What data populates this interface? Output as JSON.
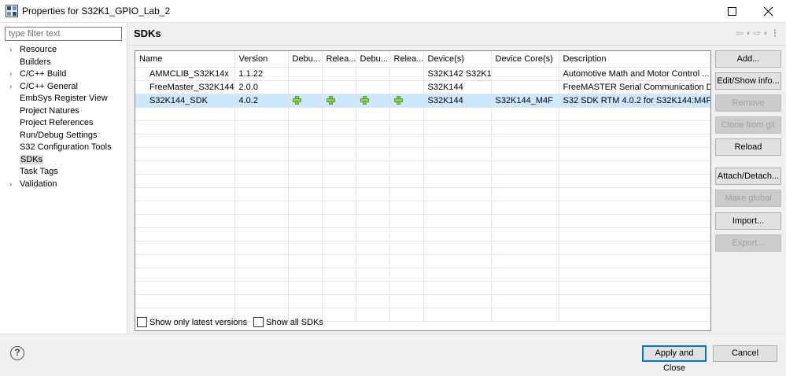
{
  "window": {
    "title": "Properties for S32K1_GPIO_Lab_2"
  },
  "filter": {
    "placeholder": "type filter text"
  },
  "tree": [
    {
      "label": "Resource",
      "expandable": true
    },
    {
      "label": "Builders",
      "expandable": false
    },
    {
      "label": "C/C++ Build",
      "expandable": true
    },
    {
      "label": "C/C++ General",
      "expandable": true
    },
    {
      "label": "EmbSys Register View",
      "expandable": false
    },
    {
      "label": "Project Natures",
      "expandable": false
    },
    {
      "label": "Project References",
      "expandable": false
    },
    {
      "label": "Run/Debug Settings",
      "expandable": false
    },
    {
      "label": "S32 Configuration Tools",
      "expandable": false
    },
    {
      "label": "SDKs",
      "expandable": false,
      "selected": true
    },
    {
      "label": "Task Tags",
      "expandable": false
    },
    {
      "label": "Validation",
      "expandable": true
    }
  ],
  "page": {
    "title": "SDKs"
  },
  "table": {
    "headers": [
      "Name",
      "Version",
      "Debu...",
      "Relea...",
      "Debu...",
      "Relea...",
      "Device(s)",
      "Device Core(s)",
      "Description"
    ],
    "rows": [
      {
        "name": "AMMCLIB_S32K14x",
        "version": "1.1.22",
        "debug1": "",
        "release1": "",
        "debug2": "",
        "release2": "",
        "devices": "S32K142 S32K1...",
        "cores": "",
        "description": "Automotive Math and Motor Control ..."
      },
      {
        "name": "FreeMaster_S32K144",
        "version": "2.0.0",
        "debug1": "",
        "release1": "",
        "debug2": "",
        "release2": "",
        "devices": "S32K144",
        "cores": "",
        "description": "FreeMASTER Serial Communication D..."
      },
      {
        "name": "S32K144_SDK",
        "version": "4.0.2",
        "debug1": "plus-icon",
        "release1": "plus-icon",
        "debug2": "plus-icon",
        "release2": "plus-icon",
        "devices": "S32K144",
        "cores": "S32K144_M4F",
        "description": "S32 SDK RTM 4.0.2 for S32K144:M4F",
        "selected": true
      }
    ]
  },
  "buttons": {
    "add": "Add...",
    "edit": "Edit/Show info...",
    "remove": "Remove",
    "clone": "Clone from git",
    "reload": "Reload",
    "attach": "Attach/Detach...",
    "make_global": "Make global",
    "import": "Import...",
    "export": "Export..."
  },
  "checkboxes": {
    "latest": "Show only latest versions",
    "all": "Show all SDKs"
  },
  "footer": {
    "apply": "Apply and Close",
    "cancel": "Cancel",
    "help": "?"
  },
  "colors": {
    "selection": "#cce8ff",
    "accent": "#0078d7"
  }
}
